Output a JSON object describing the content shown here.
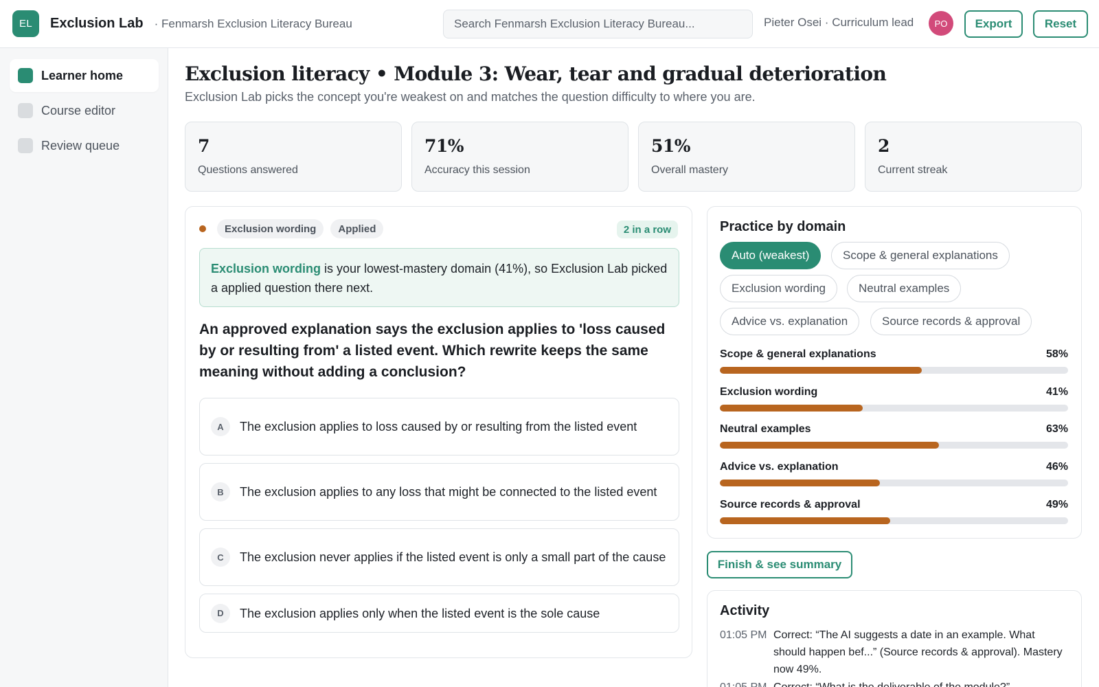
{
  "topbar": {
    "logo_initials": "EL",
    "app_name": "Exclusion Lab",
    "org_name": "· Fenmarsh Exclusion Literacy Bureau",
    "search_placeholder": "Search Fenmarsh Exclusion Literacy Bureau...",
    "user_label": "Pieter Osei · Curriculum lead",
    "avatar_initials": "PO",
    "export_label": "Export",
    "reset_label": "Reset"
  },
  "sidebar": {
    "items": [
      {
        "label": "Learner home",
        "active": true
      },
      {
        "label": "Course editor",
        "active": false
      },
      {
        "label": "Review queue",
        "active": false
      }
    ]
  },
  "main": {
    "title": "Exclusion literacy • Module 3: Wear, tear and gradual deterioration",
    "subtitle": "Exclusion Lab picks the concept you're weakest on and matches the question difficulty to where you are."
  },
  "stats": [
    {
      "value": "7",
      "label": "Questions answered"
    },
    {
      "value": "71%",
      "label": "Accuracy this session"
    },
    {
      "value": "51%",
      "label": "Overall mastery"
    },
    {
      "value": "2",
      "label": "Current streak"
    }
  ],
  "question": {
    "domain_tag": "Exclusion wording",
    "difficulty_tag": "Applied",
    "streak_badge": "2 in a row",
    "hint_highlight": "Exclusion wording",
    "hint_rest": " is your lowest-mastery domain (41%), so Exclusion Lab picked a applied question there next.",
    "text": "An approved explanation says the exclusion applies to 'loss caused by or resulting from' a listed event. Which rewrite keeps the same meaning without adding a conclusion?",
    "options": [
      {
        "letter": "A",
        "text": "The exclusion applies to loss caused by or resulting from the listed event"
      },
      {
        "letter": "B",
        "text": "The exclusion applies to any loss that might be connected to the listed event"
      },
      {
        "letter": "C",
        "text": "The exclusion never applies if the listed event is only a small part of the cause"
      },
      {
        "letter": "D",
        "text": "The exclusion applies only when the listed event is the sole cause"
      }
    ]
  },
  "practice": {
    "title": "Practice by domain",
    "chips": [
      {
        "label": "Auto (weakest)",
        "active": true
      },
      {
        "label": "Scope & general explanations",
        "active": false
      },
      {
        "label": "Exclusion wording",
        "active": false
      },
      {
        "label": "Neutral examples",
        "active": false
      },
      {
        "label": "Advice vs. explanation",
        "active": false
      },
      {
        "label": "Source records & approval",
        "active": false
      }
    ],
    "mastery": [
      {
        "name": "Scope & general explanations",
        "pct_label": "58%",
        "value": 58
      },
      {
        "name": "Exclusion wording",
        "pct_label": "41%",
        "value": 41
      },
      {
        "name": "Neutral examples",
        "pct_label": "63%",
        "value": 63
      },
      {
        "name": "Advice vs. explanation",
        "pct_label": "46%",
        "value": 46
      },
      {
        "name": "Source records & approval",
        "pct_label": "49%",
        "value": 49
      }
    ],
    "bar_color": "#b8651f"
  },
  "finish_label": "Finish & see summary",
  "activity": {
    "title": "Activity",
    "entries": [
      {
        "time": "01:05 PM",
        "text": "Correct: “The AI suggests a date in an example. What should happen bef...” (Source records & approval). Mastery now 49%."
      },
      {
        "time": "01:05 PM",
        "text": "Correct: “What is the deliverable of the module?”"
      }
    ]
  },
  "colors": {
    "accent": "#2a8c73",
    "avatar": "#d24a7a",
    "progress": "#b8651f"
  }
}
